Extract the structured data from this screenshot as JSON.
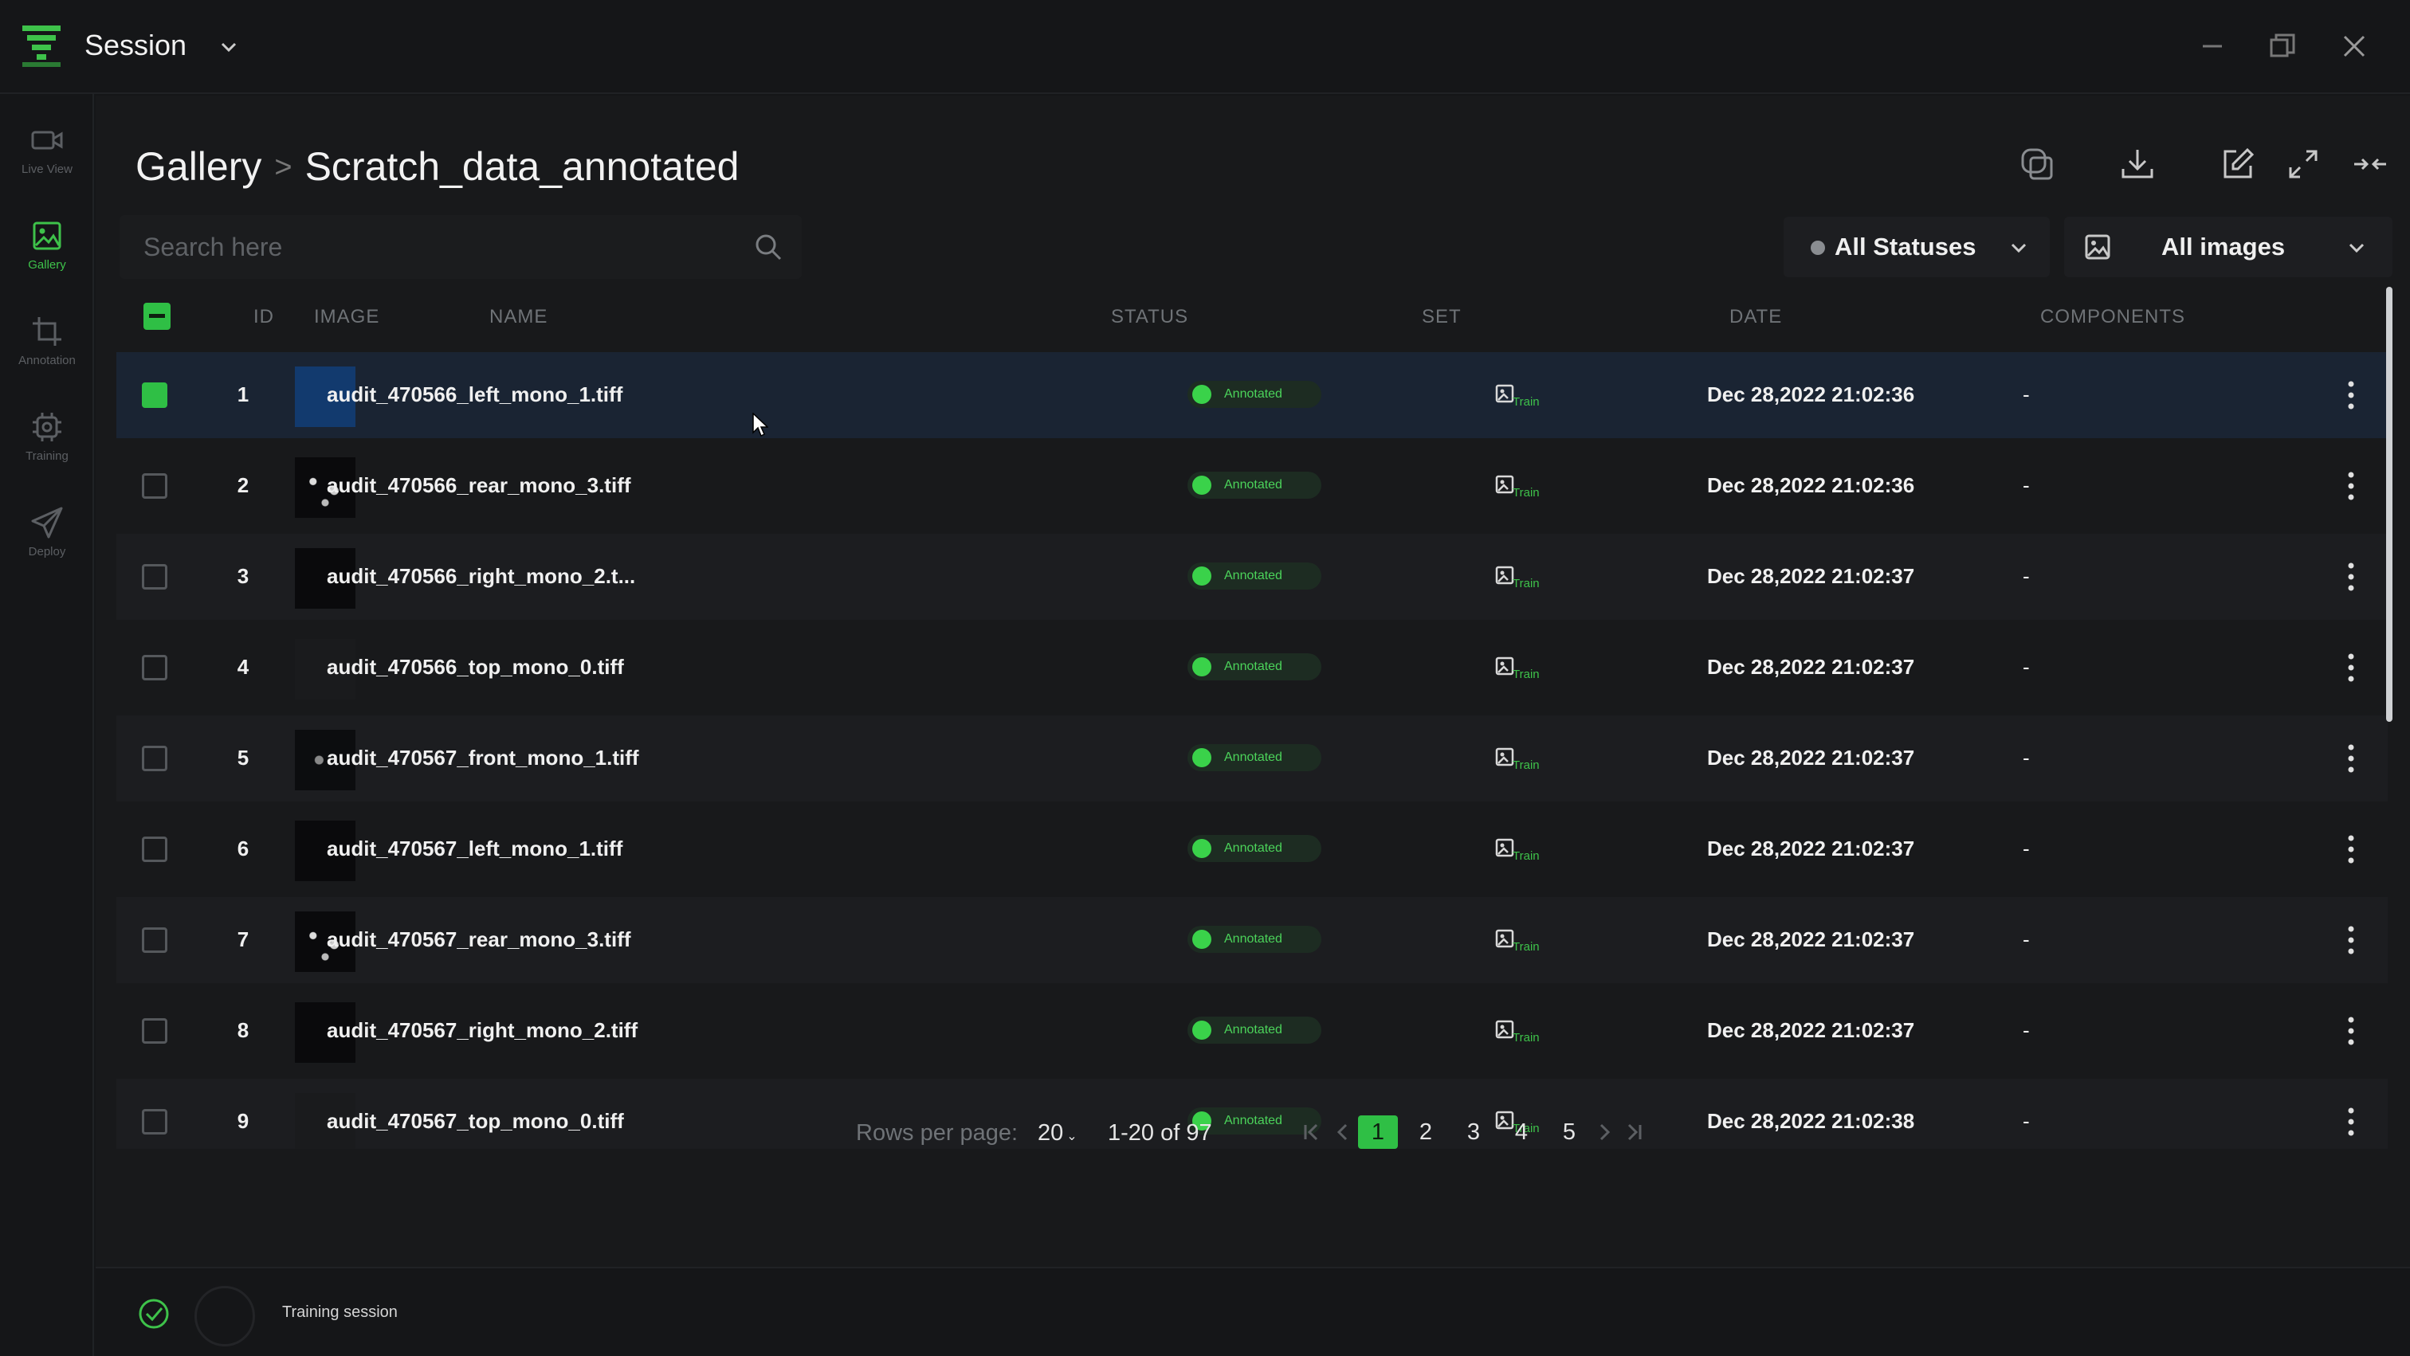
{
  "app": {
    "title": "Session"
  },
  "sidebar": {
    "items": [
      {
        "label": "Live View",
        "icon": "video-camera-icon"
      },
      {
        "label": "Gallery",
        "icon": "image-icon",
        "active": true
      },
      {
        "label": "Annotation",
        "icon": "crop-icon"
      },
      {
        "label": "Training",
        "icon": "chip-icon"
      },
      {
        "label": "Deploy",
        "icon": "send-icon"
      }
    ]
  },
  "breadcrumb": {
    "root": "Gallery",
    "separator": ">",
    "current": "Scratch_data_annotated"
  },
  "search": {
    "placeholder": "Search here"
  },
  "filters": {
    "status": "All Statuses",
    "images": "All images"
  },
  "table": {
    "headers": {
      "id": "ID",
      "image": "IMAGE",
      "name": "NAME",
      "status": "STATUS",
      "set": "SET",
      "date": "DATE",
      "components": "COMPONENTS"
    },
    "rows": [
      {
        "id": "1",
        "name": "audit_470566_left_mono_1.tiff",
        "status": "Annotated",
        "set": "Train",
        "date": "Dec 28,2022 21:02:36",
        "components": "-",
        "selected": true
      },
      {
        "id": "2",
        "name": "audit_470566_rear_mono_3.tiff",
        "status": "Annotated",
        "set": "Train",
        "date": "Dec 28,2022 21:02:36",
        "components": "-"
      },
      {
        "id": "3",
        "name": "audit_470566_right_mono_2.t...",
        "status": "Annotated",
        "set": "Train",
        "date": "Dec 28,2022 21:02:37",
        "components": "-"
      },
      {
        "id": "4",
        "name": "audit_470566_top_mono_0.tiff",
        "status": "Annotated",
        "set": "Train",
        "date": "Dec 28,2022 21:02:37",
        "components": "-"
      },
      {
        "id": "5",
        "name": "audit_470567_front_mono_1.tiff",
        "status": "Annotated",
        "set": "Train",
        "date": "Dec 28,2022 21:02:37",
        "components": "-"
      },
      {
        "id": "6",
        "name": "audit_470567_left_mono_1.tiff",
        "status": "Annotated",
        "set": "Train",
        "date": "Dec 28,2022 21:02:37",
        "components": "-"
      },
      {
        "id": "7",
        "name": "audit_470567_rear_mono_3.tiff",
        "status": "Annotated",
        "set": "Train",
        "date": "Dec 28,2022 21:02:37",
        "components": "-"
      },
      {
        "id": "8",
        "name": "audit_470567_right_mono_2.tiff",
        "status": "Annotated",
        "set": "Train",
        "date": "Dec 28,2022 21:02:37",
        "components": "-"
      },
      {
        "id": "9",
        "name": "audit_470567_top_mono_0.tiff",
        "status": "Annotated",
        "set": "Train",
        "date": "Dec 28,2022 21:02:38",
        "components": "-"
      }
    ]
  },
  "pagination": {
    "rows_per_page_label": "Rows per page:",
    "rows_per_page": "20",
    "range": "1-20 of 97",
    "pages": [
      "1",
      "2",
      "3",
      "4",
      "5"
    ],
    "current_page": "1"
  },
  "footer": {
    "status_text": "Training session"
  },
  "colors": {
    "accent": "#2fbf45",
    "background": "#18191b",
    "selected_row": "#1a2433"
  }
}
